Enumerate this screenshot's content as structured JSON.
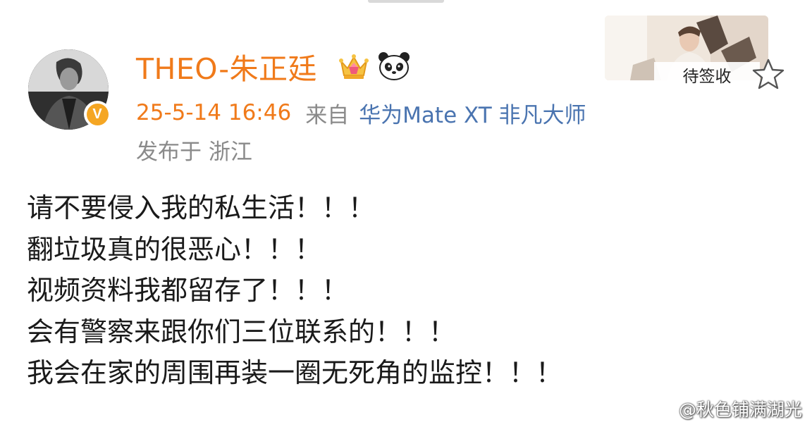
{
  "post": {
    "username": "THEO-朱正廷",
    "timestamp": "25-5-14 16:46",
    "from_label": "来自",
    "device": "华为Mate XT 非凡大师",
    "location": "发布于 浙江",
    "verified_badge": "V",
    "body_lines": [
      "请不要侵入我的私生活！！！",
      "翻垃圾真的很恶心！！！",
      "视频资料我都留存了！！！",
      "会有警察来跟你们三位联系的！！！",
      "我会在家的周围再装一圈无死角的监控！！！"
    ]
  },
  "card": {
    "label": "待签收"
  },
  "watermark": {
    "text": "@秋色铺满湖光"
  },
  "icons": {
    "crown": "crown-icon",
    "panda": "panda-icon",
    "star": "star-icon",
    "weibo": "weibo-logo-icon"
  },
  "colors": {
    "username": "#f07a1a",
    "timestamp": "#f07a1a",
    "device_link": "#4a74b0",
    "secondary_text": "#8a8a8a",
    "body_text": "#1a1a1a",
    "verified_badge": "#f5a623"
  }
}
